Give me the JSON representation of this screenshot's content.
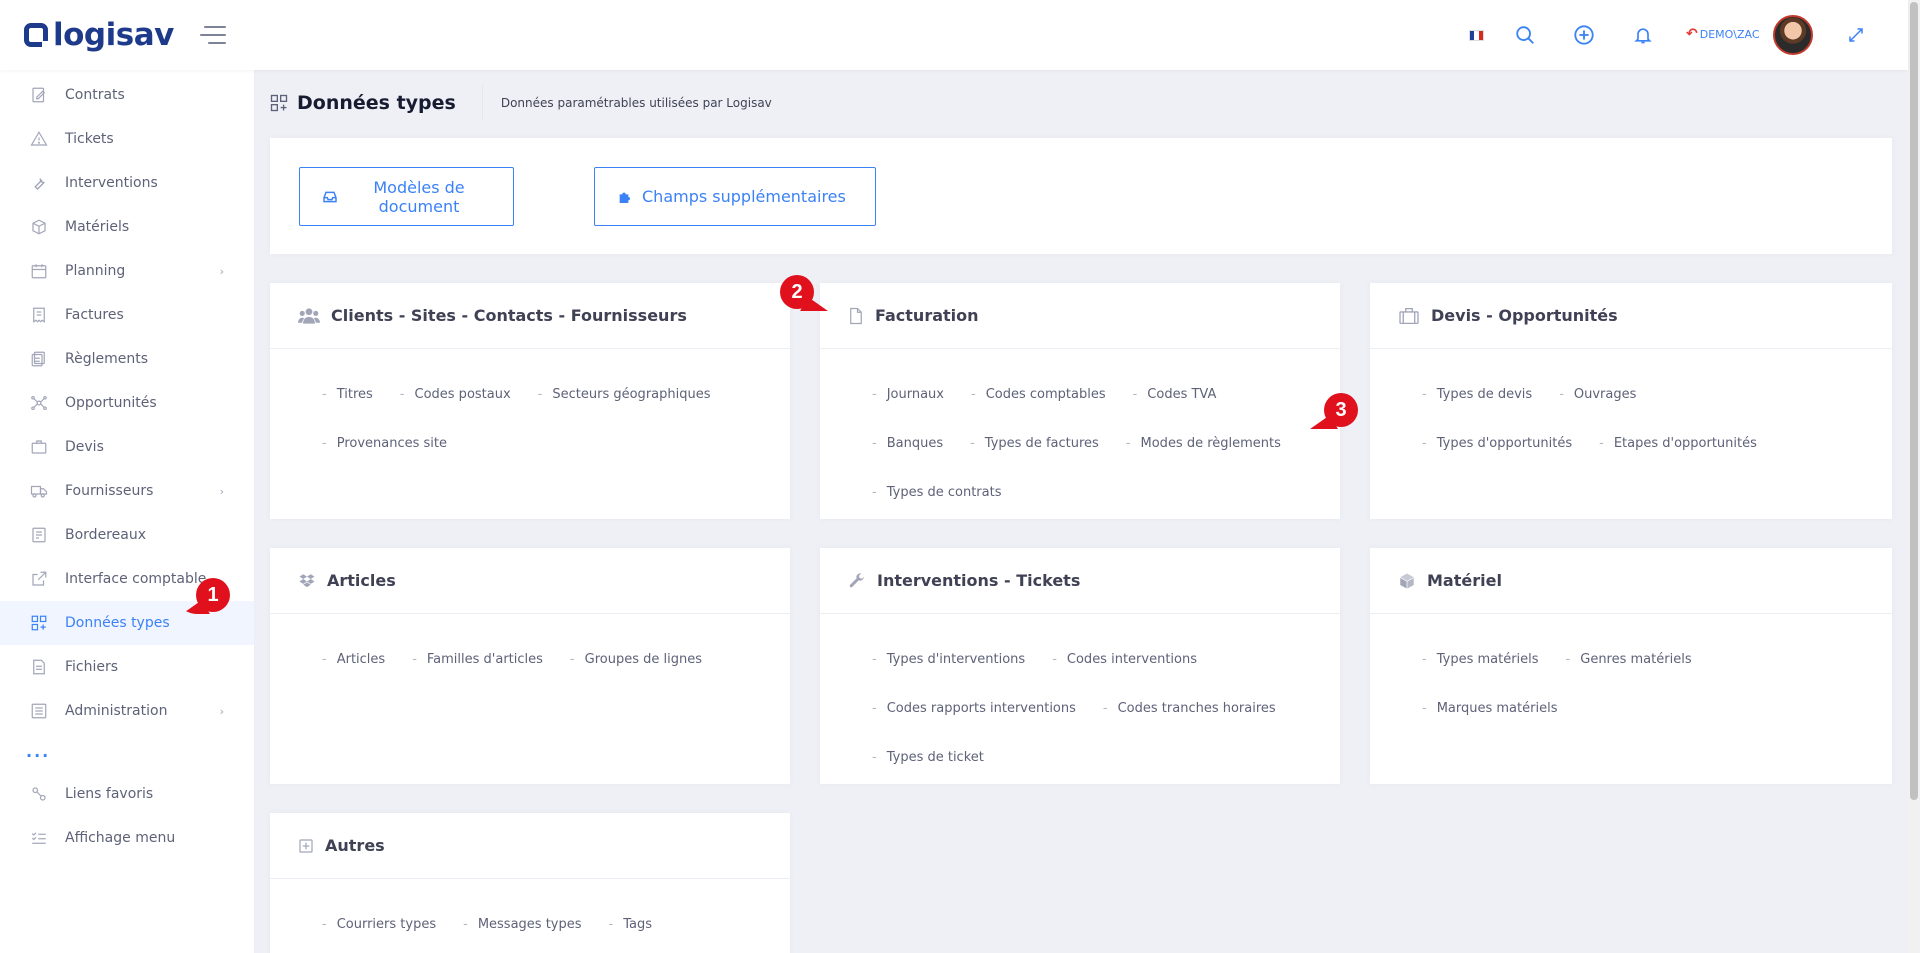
{
  "app": {
    "logo_text": "logisav"
  },
  "header": {
    "user_label": "DEMO\\ZAC",
    "flag_colors": [
      "#1f3f99",
      "#ffffff",
      "#d52b1e"
    ],
    "accent": "#3b82f6"
  },
  "sidebar": {
    "items": [
      {
        "label": "Contrats",
        "icon": "contract-icon"
      },
      {
        "label": "Tickets",
        "icon": "warning-icon"
      },
      {
        "label": "Interventions",
        "icon": "wrench-icon"
      },
      {
        "label": "Matériels",
        "icon": "box-icon"
      },
      {
        "label": "Planning",
        "icon": "calendar-icon"
      },
      {
        "label": "Factures",
        "icon": "invoice-icon"
      },
      {
        "label": "Règlements",
        "icon": "payments-icon"
      },
      {
        "label": "Opportunités",
        "icon": "network-icon"
      },
      {
        "label": "Devis",
        "icon": "briefcase-icon"
      },
      {
        "label": "Fournisseurs",
        "icon": "truck-icon"
      },
      {
        "label": "Bordereaux",
        "icon": "slip-icon"
      },
      {
        "label": "Interface comptable",
        "icon": "external-link-icon"
      },
      {
        "label": "Données types",
        "icon": "grid-plus-icon"
      },
      {
        "label": "Fichiers",
        "icon": "file-icon"
      },
      {
        "label": "Administration",
        "icon": "settings-list-icon"
      }
    ],
    "dots": "...",
    "footer": [
      {
        "label": "Liens favoris",
        "icon": "link-icon"
      },
      {
        "label": "Affichage menu",
        "icon": "menu-list-icon"
      }
    ]
  },
  "page": {
    "title": "Données types",
    "subtitle": "Données paramétrables utilisées par Logisav"
  },
  "toolbar": {
    "doc_models_label": "Modèles de document",
    "extra_fields_label": "Champs supplémentaires"
  },
  "sections": {
    "clients": {
      "title": "Clients - Sites - Contacts - Fournisseurs",
      "links": [
        "Titres",
        "Codes postaux",
        "Secteurs géographiques",
        "Provenances site"
      ]
    },
    "facturation": {
      "title": "Facturation",
      "links": [
        "Journaux",
        "Codes comptables",
        "Codes TVA",
        "Banques",
        "Types de factures",
        "Modes de règlements",
        "Types de contrats"
      ]
    },
    "devis": {
      "title": "Devis - Opportunités",
      "links": [
        "Types de devis",
        "Ouvrages",
        "Types d'opportunités",
        "Etapes d'opportunités"
      ]
    },
    "articles": {
      "title": "Articles",
      "links": [
        "Articles",
        "Familles d'articles",
        "Groupes de lignes"
      ]
    },
    "interventions": {
      "title": "Interventions - Tickets",
      "links": [
        "Types d'interventions",
        "Codes interventions",
        "Codes rapports interventions",
        "Codes tranches horaires",
        "Types de ticket"
      ]
    },
    "materiel": {
      "title": "Matériel",
      "links": [
        "Types matériels",
        "Genres matériels",
        "Marques matériels"
      ]
    },
    "autres": {
      "title": "Autres",
      "links": [
        "Courriers types",
        "Messages types",
        "Tags"
      ]
    }
  },
  "markers": {
    "m1": "1",
    "m2": "2",
    "m3": "3"
  }
}
